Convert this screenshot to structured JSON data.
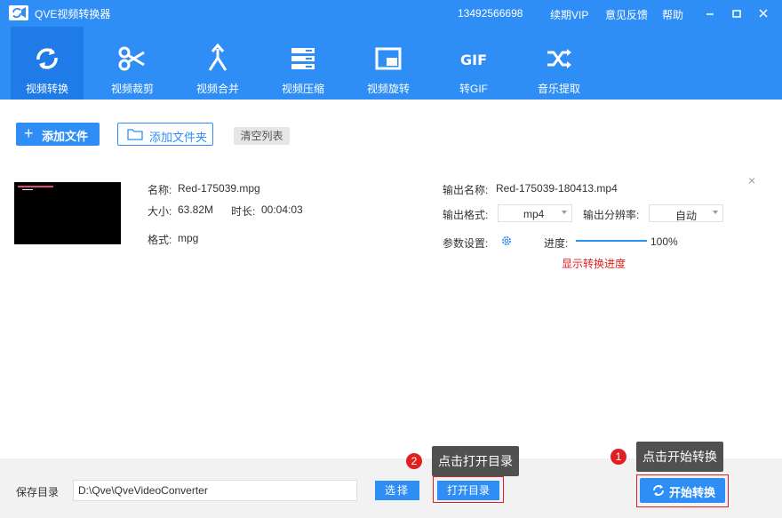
{
  "window": {
    "title": "QVE视频转换器",
    "phone": "13492566698",
    "links": [
      "续期VIP",
      "意见反馈",
      "帮助"
    ]
  },
  "toolbar": {
    "items": [
      {
        "label": "视频转换",
        "icon": "convert-icon",
        "active": true
      },
      {
        "label": "视频裁剪",
        "icon": "scissors-icon",
        "active": false
      },
      {
        "label": "视频合并",
        "icon": "merge-icon",
        "active": false
      },
      {
        "label": "视频压缩",
        "icon": "compress-icon",
        "active": false
      },
      {
        "label": "视频旋转",
        "icon": "rotate-icon",
        "active": false
      },
      {
        "label": "转GIF",
        "icon": "gif-icon",
        "active": false
      },
      {
        "label": "音乐提取",
        "icon": "shuffle-icon",
        "active": false
      }
    ]
  },
  "actions": {
    "add_file": "添加文件",
    "add_folder": "添加文件夹",
    "clear_list": "清空列表"
  },
  "file": {
    "name_label": "名称:",
    "name": "Red-175039.mpg",
    "size_label": "大小:",
    "size": "63.82M",
    "duration_label": "时长:",
    "duration": "00:04:03",
    "format_label": "格式:",
    "format": "mpg",
    "output_name_label": "输出名称:",
    "output_name": "Red-175039-180413.mp4",
    "output_format_label": "输出格式:",
    "output_format": "mp4",
    "output_resolution_label": "输出分辨率:",
    "output_resolution": "自动",
    "params_label": "参数设置:",
    "progress_label": "进度:",
    "progress_text": "100%",
    "progress_value": 1.0
  },
  "annotations": {
    "progress_note": "显示转换进度",
    "step1_number": "1",
    "step1_text": "点击开始转换",
    "step2_number": "2",
    "step2_text": "点击打开目录"
  },
  "bottom": {
    "save_label": "保存目录",
    "save_path": "D:\\Qve\\QveVideoConverter",
    "choose": "选择",
    "open_dir": "打开目录",
    "start": "开始转换"
  },
  "colors": {
    "accent": "#2f8ef5",
    "accent_active": "#1f7be8",
    "annotation_red": "#e02020"
  }
}
